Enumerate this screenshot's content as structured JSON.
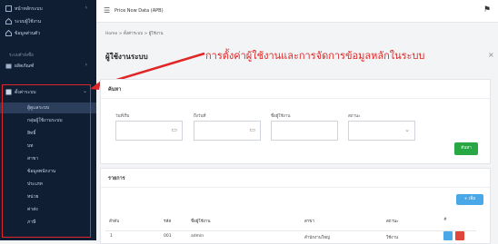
{
  "sidebar": {
    "top_items": [
      {
        "label": "หน้าหลักระบบ",
        "icon": "dashboard-icon"
      },
      {
        "label": "ระบบผู้ใช้งาน",
        "icon": "home-icon"
      },
      {
        "label": "ข้อมูลส่วนตัว",
        "icon": "home-icon"
      }
    ],
    "section_label": "ระบบคำสั่งซื้อ",
    "mid_items": [
      {
        "label": "ผลิตภัณฑ์",
        "icon": "box-icon"
      },
      {
        "label": "ตั้งค่าระบบ",
        "icon": "settings-icon"
      }
    ],
    "sub_items": [
      "ผู้ดูแลระบบ",
      "กลุ่มผู้ใช้งานระบบ",
      "สิทธิ์",
      "บท",
      "สาขา",
      "ข้อมูลพนักงาน",
      "ประเภท",
      "หน่วย",
      "ค่าส่ง",
      "ภาษี"
    ]
  },
  "header": {
    "title": "Price Now Data (APB)"
  },
  "breadcrumb": "Home > ตั้งค่าระบบ > ผู้ใช้งาน",
  "page_title": "ผู้ใช้งานระบบ",
  "annotation": "การตั้งค่าผู้ใช้งานและการจัดการข้อมูลหลักในระบบ",
  "search": {
    "title": "ค้นหา",
    "fields": [
      {
        "label": "วันที่เริ่ม",
        "value": ""
      },
      {
        "label": "ถึงวันที่",
        "value": ""
      },
      {
        "label": "ชื่อผู้ใช้งาน",
        "value": ""
      },
      {
        "label": "สถานะ",
        "value": ""
      }
    ],
    "button": "ค้นหา"
  },
  "results": {
    "title": "รายการ",
    "add_button": "+ เพิ่ม",
    "columns": [
      "ลำดับ",
      "รหัส",
      "ชื่อผู้ใช้งาน",
      "สาขา",
      "สถานะ",
      "#"
    ],
    "rows": [
      {
        "no": "1",
        "code": "001",
        "name": "admin",
        "branch": "สำนักงานใหญ่",
        "status": "ใช้งาน"
      }
    ]
  },
  "colors": {
    "sidebar": "#0f1e33",
    "highlight": "#e02626",
    "green": "#28a745",
    "blue": "#4aa8e8"
  }
}
